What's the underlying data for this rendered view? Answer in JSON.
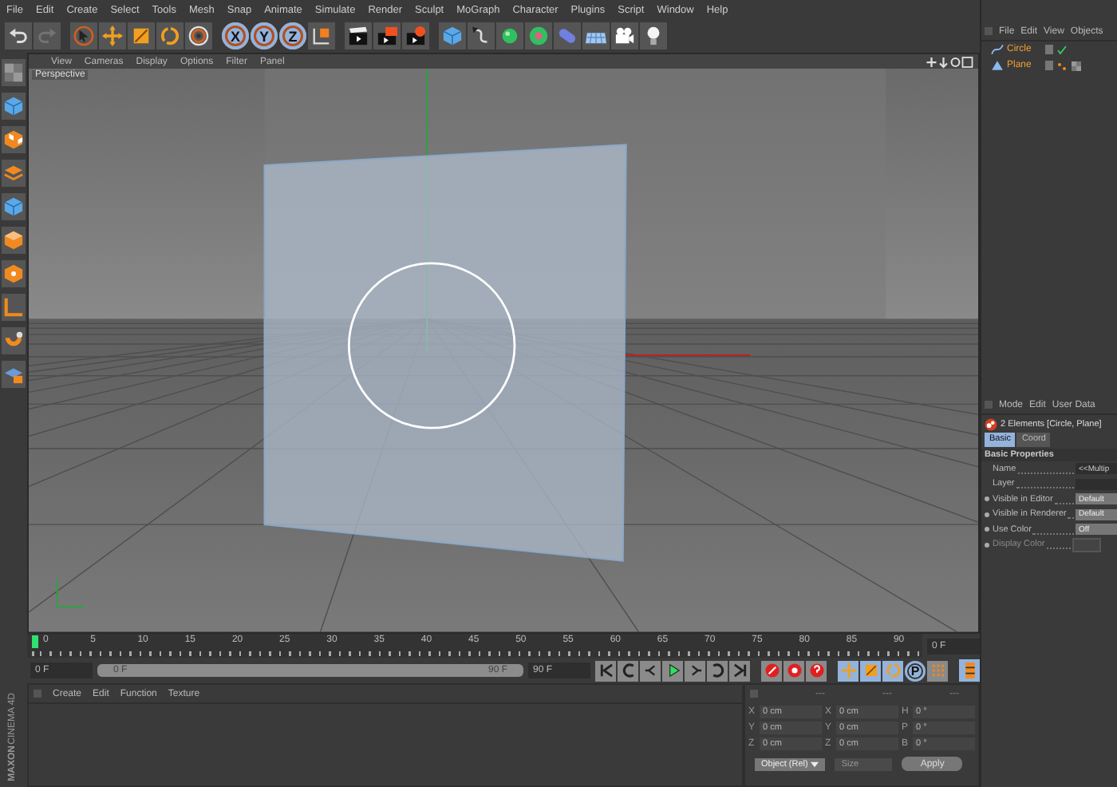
{
  "menu_bar": [
    "File",
    "Edit",
    "Create",
    "Select",
    "Tools",
    "Mesh",
    "Snap",
    "Animate",
    "Simulate",
    "Render",
    "Sculpt",
    "MoGraph",
    "Character",
    "Plugins",
    "Script",
    "Window",
    "Help"
  ],
  "toolbar": [
    {
      "items": [
        {
          "kind": "undo",
          "selected": false,
          "disabled": false
        },
        {
          "kind": "redo",
          "selected": false,
          "disabled": true
        }
      ]
    },
    {
      "items": [
        {
          "kind": "select",
          "selected": false,
          "disabled": false
        },
        {
          "kind": "move",
          "selected": false,
          "disabled": false
        },
        {
          "kind": "scale",
          "selected": false,
          "disabled": false
        },
        {
          "kind": "rotate",
          "selected": false,
          "disabled": false
        },
        {
          "kind": "target",
          "selected": false,
          "disabled": false
        }
      ]
    },
    {
      "items": [
        {
          "kind": "axis",
          "label": "X",
          "selected": true,
          "disabled": false
        },
        {
          "kind": "axis",
          "label": "Y",
          "selected": true,
          "disabled": false
        },
        {
          "kind": "axis",
          "label": "Z",
          "selected": true,
          "disabled": false
        },
        {
          "kind": "world",
          "selected": false,
          "disabled": false
        }
      ]
    },
    {
      "items": [
        {
          "kind": "clapper",
          "selected": false,
          "disabled": false
        },
        {
          "kind": "clapper-play",
          "selected": false,
          "disabled": false
        },
        {
          "kind": "clapper-gear",
          "selected": false,
          "disabled": false
        }
      ]
    },
    {
      "items": [
        {
          "kind": "cube",
          "selected": false,
          "disabled": false
        },
        {
          "kind": "pen",
          "selected": false,
          "disabled": false
        },
        {
          "kind": "sphere",
          "selected": false,
          "disabled": false
        },
        {
          "kind": "flower",
          "selected": false,
          "disabled": false
        },
        {
          "kind": "pill",
          "selected": false,
          "disabled": false
        },
        {
          "kind": "floor",
          "selected": false,
          "disabled": false
        },
        {
          "kind": "camera",
          "selected": false,
          "disabled": false
        },
        {
          "kind": "bulb",
          "selected": false,
          "disabled": false
        }
      ]
    }
  ],
  "left_tools": [
    {
      "kind": "checker"
    },
    {
      "kind": "cube"
    },
    {
      "kind": "checker-cube"
    },
    {
      "kind": "layers"
    },
    {
      "kind": "cube"
    },
    {
      "kind": "cube-blue"
    },
    {
      "kind": "cube-dot"
    },
    {
      "kind": "corner"
    },
    {
      "kind": "magnet"
    },
    {
      "kind": "lock"
    }
  ],
  "viewport": {
    "menu": [
      "View",
      "Cameras",
      "Display",
      "Options",
      "Filter",
      "Panel"
    ],
    "camera_label": "Perspective"
  },
  "objects": {
    "menu": [
      "File",
      "Edit",
      "View",
      "Objects"
    ],
    "items": [
      {
        "name": "Circle",
        "kind": "spline",
        "selected": true,
        "tags": [
          {
            "kind": "check"
          }
        ]
      },
      {
        "name": "Plane",
        "kind": "polygon",
        "selected": true,
        "tags": [
          {
            "kind": "dots"
          },
          {
            "kind": "checker"
          }
        ]
      }
    ]
  },
  "attributes": {
    "menu": [
      "Mode",
      "Edit",
      "User Data"
    ],
    "summary": "2 Elements [Circle, Plane]",
    "tabs": [
      {
        "label": "Basic",
        "selected": true
      },
      {
        "label": "Coord",
        "selected": false
      }
    ],
    "section": "Basic Properties",
    "fields": [
      {
        "label": "Name",
        "kind": "text",
        "value": "<<Multip",
        "bullet": false,
        "disabled": false
      },
      {
        "label": "Layer",
        "kind": "text",
        "bullet": false,
        "disabled": false
      },
      {
        "label": "Visible in Editor",
        "kind": "dropdown",
        "value": "Default",
        "bullet": true,
        "disabled": false
      },
      {
        "label": "Visible in Renderer",
        "kind": "dropdown",
        "value": "Default",
        "bullet": true,
        "disabled": false
      },
      {
        "label": "Use Color",
        "kind": "dropdown",
        "value": "Off",
        "bullet": true,
        "disabled": false
      },
      {
        "label": "Display Color",
        "kind": "color",
        "bullet": true,
        "disabled": true
      }
    ]
  },
  "timeline": {
    "ruler": [
      "0",
      "5",
      "10",
      "15",
      "20",
      "25",
      "30",
      "35",
      "40",
      "45",
      "50",
      "55",
      "60",
      "65",
      "70",
      "75",
      "80",
      "85",
      "90"
    ],
    "frame_field": "0 F",
    "current_frame": "0 F",
    "range_start": "0 F",
    "range_end": "90 F",
    "range": {
      "level": 1
    },
    "end_frame": "90 F",
    "transport": [
      {
        "kind": "first"
      },
      {
        "kind": "prev-key"
      },
      {
        "kind": "prev-frame"
      },
      {
        "kind": "play"
      },
      {
        "kind": "next-frame"
      },
      {
        "kind": "next-key"
      },
      {
        "kind": "last"
      }
    ],
    "record": [
      {
        "kind": "record"
      },
      {
        "kind": "auto-key"
      },
      {
        "kind": "key-help"
      }
    ],
    "keys": [
      {
        "kind": "move",
        "selected": true
      },
      {
        "kind": "scale",
        "selected": true
      },
      {
        "kind": "rotate",
        "selected": true
      },
      {
        "kind": "param",
        "label": "P",
        "selected": true
      },
      {
        "kind": "points",
        "selected": false
      }
    ],
    "layout": {
      "kind": "timeline-toggle"
    }
  },
  "materials": {
    "menu": [
      "Create",
      "Edit",
      "Function",
      "Texture"
    ]
  },
  "coordinates": {
    "headers": [
      "---",
      "---",
      "---"
    ],
    "columns": [
      [
        {
          "axis": "X",
          "value": "0 cm"
        },
        {
          "axis": "Y",
          "value": "0 cm"
        },
        {
          "axis": "Z",
          "value": "0 cm"
        }
      ],
      [
        {
          "axis": "X",
          "value": "0 cm"
        },
        {
          "axis": "Y",
          "value": "0 cm"
        },
        {
          "axis": "Z",
          "value": "0 cm"
        }
      ],
      [
        {
          "axis": "H",
          "value": "0 °"
        },
        {
          "axis": "P",
          "value": "0 °"
        },
        {
          "axis": "B",
          "value": "0 °"
        }
      ]
    ],
    "mode_dropdown": {
      "label": "Object (Rel)",
      "disabled": false
    },
    "size_dropdown": {
      "label": "Size",
      "disabled": true
    },
    "apply": "Apply"
  },
  "logo": {
    "brand": "MAXON",
    "product": "CINEMA 4D"
  }
}
